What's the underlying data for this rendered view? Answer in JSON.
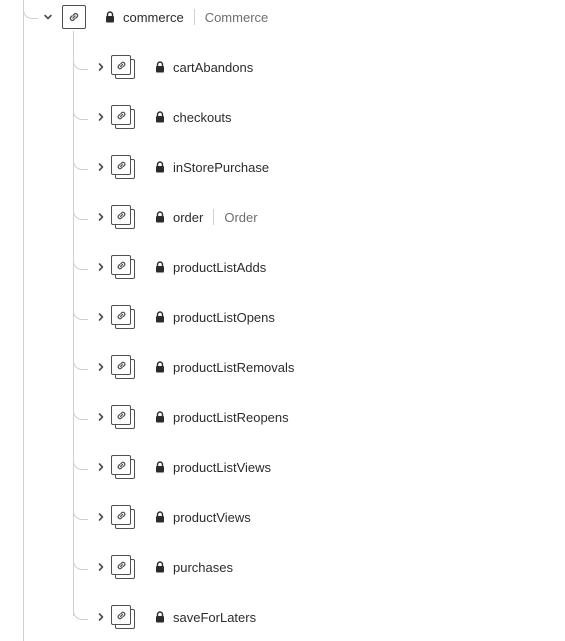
{
  "root": {
    "name": "commerce",
    "title": "Commerce",
    "expanded": true,
    "icon": "link-icon"
  },
  "children": [
    {
      "name": "cartAbandons",
      "title": ""
    },
    {
      "name": "checkouts",
      "title": ""
    },
    {
      "name": "inStorePurchase",
      "title": ""
    },
    {
      "name": "order",
      "title": "Order"
    },
    {
      "name": "productListAdds",
      "title": ""
    },
    {
      "name": "productListOpens",
      "title": ""
    },
    {
      "name": "productListRemovals",
      "title": ""
    },
    {
      "name": "productListReopens",
      "title": ""
    },
    {
      "name": "productListViews",
      "title": ""
    },
    {
      "name": "productViews",
      "title": ""
    },
    {
      "name": "purchases",
      "title": ""
    },
    {
      "name": "saveForLaters",
      "title": ""
    }
  ],
  "colors": {
    "guide_line": "#cfcfcf",
    "icon_stroke": "#505050",
    "label_text": "#2c2c2c",
    "title_text": "#6e6e6e"
  }
}
